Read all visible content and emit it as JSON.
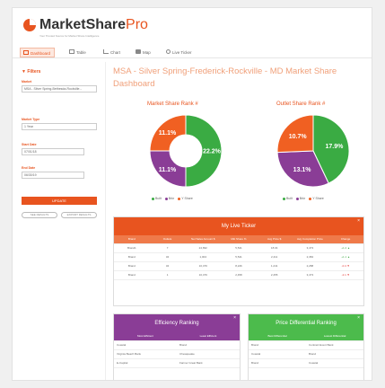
{
  "brand": {
    "name": "MarketShare",
    "suffix": "Pro",
    "tagline": "Your Trusted Source for Market Share Intelligence"
  },
  "nav": {
    "tabs": [
      {
        "label": "Dashboard",
        "icon": "monitor-icon"
      },
      {
        "label": "Table",
        "icon": "table-icon"
      },
      {
        "label": "Chart",
        "icon": "chart-icon"
      },
      {
        "label": "Map",
        "icon": "map-icon"
      },
      {
        "label": "Live Ticker",
        "icon": "clock-icon"
      }
    ],
    "active": "Dashboard"
  },
  "sidebar": {
    "title": "Filters",
    "fields": [
      {
        "label": "Market",
        "value": "MSA - Silver Spring-Bethesda-Rockville..."
      },
      {
        "label": "Market Type",
        "value": "1 Year"
      },
      {
        "label": "Start Date",
        "value": "07/01/18"
      },
      {
        "label": "End Date",
        "value": "06/30/19"
      }
    ],
    "update_label": "UPDATE",
    "buttons": [
      "SEE RESULTS",
      "EXPORT RESULTS"
    ]
  },
  "main": {
    "title": "MSA - Silver Spring-Frederick-Rockville - MD Market Share Dashboard"
  },
  "charts": [
    {
      "title": "Market Share Rank #",
      "labels": [
        "22.2%",
        "11.1%",
        "11.1%"
      ]
    },
    {
      "title": "Outlet Share Rank #",
      "labels": [
        "17.9%",
        "13.1%",
        "10.7%"
      ]
    }
  ],
  "chart_data": [
    {
      "type": "pie",
      "title": "Market Share Rank #",
      "donut": true,
      "categories": [
        "Built",
        "Brkr",
        "Y Share"
      ],
      "values": [
        22.2,
        11.1,
        11.1
      ],
      "colors": [
        "#3aab43",
        "#8a3d96",
        "#f06022"
      ]
    },
    {
      "type": "pie",
      "title": "Outlet Share Rank #",
      "donut": false,
      "categories": [
        "Built",
        "Brkr",
        "Y Share"
      ],
      "values": [
        17.9,
        13.1,
        10.7
      ],
      "colors": [
        "#3aab43",
        "#8a3d96",
        "#f06022"
      ]
    }
  ],
  "ticker": {
    "title": "My Live Ticker",
    "headers": [
      "Brand",
      "Outlets",
      "Net Sales Amount $",
      "Mkt Share %",
      "Avg Price $",
      "Avg Completion Price",
      "Change"
    ],
    "rows": [
      {
        "cells": [
          "Brand1",
          "7",
          "24,832",
          "5,541",
          "18.04",
          "3,473"
        ],
        "change": "+1.2",
        "dir": "up"
      },
      {
        "cells": [
          "Brand",
          "34",
          "1,004",
          "5,541",
          "2,411",
          "2,384"
        ],
        "change": "+1.1",
        "dir": "up"
      },
      {
        "cells": [
          "Brand",
          "34",
          "10,479",
          "8,246",
          "1,241",
          "2,288"
        ],
        "change": "-0.4",
        "dir": "down"
      },
      {
        "cells": [
          "Brand",
          "1",
          "10,479",
          "2,458",
          "2,455",
          "3,473"
        ],
        "change": "-2.1",
        "dir": "down"
      }
    ]
  },
  "efficiency": {
    "title": "Efficiency Ranking",
    "headers": [
      "Most Efficient",
      "Least Efficient"
    ],
    "rows": [
      [
        "Coastal",
        "Brand"
      ],
      [
        "Virginia Beach Bank",
        "Chesapeake"
      ],
      [
        "E-Capital",
        "Farmer Great Bank"
      ]
    ]
  },
  "differential": {
    "title": "Price Differential Ranking",
    "headers": [
      "Best Differential",
      "Lowest Differential"
    ],
    "rows": [
      [
        "Brand",
        "Contract Event Bank"
      ],
      [
        "Coastal",
        "Brand"
      ],
      [
        "Brand",
        "Coastal"
      ]
    ]
  },
  "colors": {
    "accent": "#e8541f",
    "green": "#3aab43",
    "purple": "#8a3d96",
    "orange": "#f06022"
  }
}
